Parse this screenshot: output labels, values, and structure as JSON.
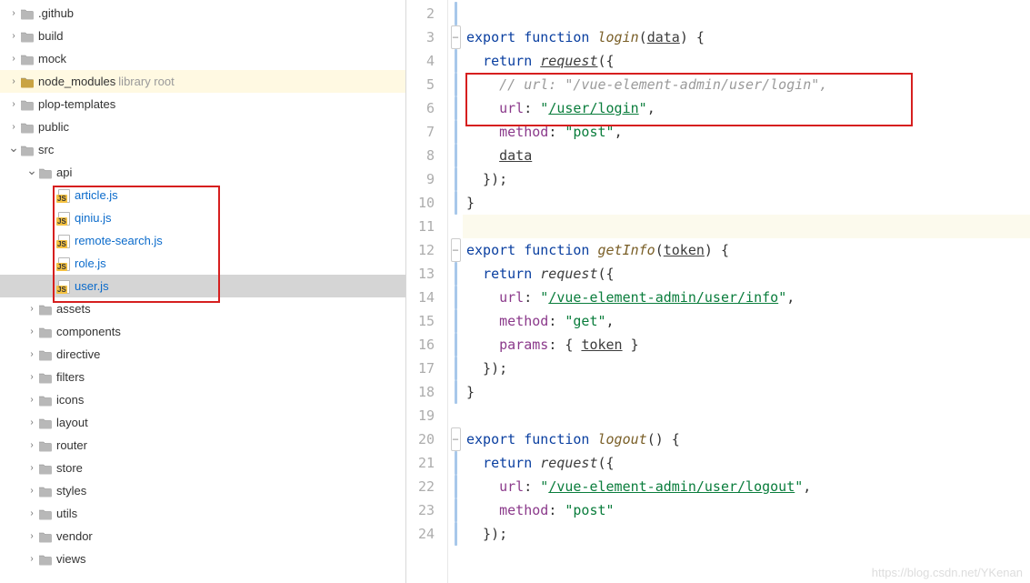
{
  "tree": [
    {
      "indent": 0,
      "chev": "right",
      "icon": "folder",
      "label": ".github"
    },
    {
      "indent": 0,
      "chev": "right",
      "icon": "folder",
      "label": "build"
    },
    {
      "indent": 0,
      "chev": "right",
      "icon": "folder",
      "label": "mock"
    },
    {
      "indent": 0,
      "chev": "right",
      "icon": "folder-lib",
      "label": "node_modules",
      "extra": "library root",
      "lib": true
    },
    {
      "indent": 0,
      "chev": "right",
      "icon": "folder",
      "label": "plop-templates"
    },
    {
      "indent": 0,
      "chev": "right",
      "icon": "folder",
      "label": "public"
    },
    {
      "indent": 0,
      "chev": "down",
      "icon": "folder",
      "label": "src"
    },
    {
      "indent": 1,
      "chev": "down",
      "icon": "folder",
      "label": "api"
    },
    {
      "indent": 2,
      "chev": "none",
      "icon": "js",
      "label": "article.js",
      "link": true
    },
    {
      "indent": 2,
      "chev": "none",
      "icon": "js",
      "label": "qiniu.js",
      "link": true
    },
    {
      "indent": 2,
      "chev": "none",
      "icon": "js",
      "label": "remote-search.js",
      "link": true
    },
    {
      "indent": 2,
      "chev": "none",
      "icon": "js",
      "label": "role.js",
      "link": true
    },
    {
      "indent": 2,
      "chev": "none",
      "icon": "js",
      "label": "user.js",
      "link": true,
      "selected": true
    },
    {
      "indent": 1,
      "chev": "right",
      "icon": "folder",
      "label": "assets"
    },
    {
      "indent": 1,
      "chev": "right",
      "icon": "folder",
      "label": "components"
    },
    {
      "indent": 1,
      "chev": "right",
      "icon": "folder",
      "label": "directive"
    },
    {
      "indent": 1,
      "chev": "right",
      "icon": "folder",
      "label": "filters"
    },
    {
      "indent": 1,
      "chev": "right",
      "icon": "folder",
      "label": "icons"
    },
    {
      "indent": 1,
      "chev": "right",
      "icon": "folder",
      "label": "layout"
    },
    {
      "indent": 1,
      "chev": "right",
      "icon": "folder",
      "label": "router"
    },
    {
      "indent": 1,
      "chev": "right",
      "icon": "folder",
      "label": "store"
    },
    {
      "indent": 1,
      "chev": "right",
      "icon": "folder",
      "label": "styles"
    },
    {
      "indent": 1,
      "chev": "right",
      "icon": "folder",
      "label": "utils"
    },
    {
      "indent": 1,
      "chev": "right",
      "icon": "folder",
      "label": "vendor"
    },
    {
      "indent": 1,
      "chev": "right",
      "icon": "folder",
      "label": "views"
    }
  ],
  "lines": [
    {
      "num": 2,
      "mark": "bar",
      "tokens": []
    },
    {
      "num": 3,
      "mark": "minus",
      "tokens": [
        {
          "t": "export ",
          "c": "kw"
        },
        {
          "t": "function ",
          "c": "kw"
        },
        {
          "t": "login",
          "c": "fn"
        },
        {
          "t": "(",
          "c": "plain"
        },
        {
          "t": "data",
          "c": "param"
        },
        {
          "t": ") {",
          "c": "plain"
        }
      ]
    },
    {
      "num": 4,
      "mark": "bar",
      "tokens": [
        {
          "t": "  ",
          "c": "plain"
        },
        {
          "t": "return ",
          "c": "kw"
        },
        {
          "t": "request",
          "c": "fncall underline"
        },
        {
          "t": "({",
          "c": "plain"
        }
      ]
    },
    {
      "num": 5,
      "mark": "bar",
      "tokens": [
        {
          "t": "    ",
          "c": "plain"
        },
        {
          "t": "// url: \"/vue-element-admin/user/login\",",
          "c": "comment"
        }
      ]
    },
    {
      "num": 6,
      "mark": "bar",
      "tokens": [
        {
          "t": "    ",
          "c": "plain"
        },
        {
          "t": "url",
          "c": "prop"
        },
        {
          "t": ": ",
          "c": "plain"
        },
        {
          "t": "\"",
          "c": "str"
        },
        {
          "t": "/user/login",
          "c": "str underline"
        },
        {
          "t": "\"",
          "c": "str"
        },
        {
          "t": ",",
          "c": "plain"
        }
      ]
    },
    {
      "num": 7,
      "mark": "bar",
      "tokens": [
        {
          "t": "    ",
          "c": "plain"
        },
        {
          "t": "method",
          "c": "prop"
        },
        {
          "t": ": ",
          "c": "plain"
        },
        {
          "t": "\"post\"",
          "c": "str"
        },
        {
          "t": ",",
          "c": "plain"
        }
      ]
    },
    {
      "num": 8,
      "mark": "bar",
      "tokens": [
        {
          "t": "    ",
          "c": "plain"
        },
        {
          "t": "data",
          "c": "param"
        }
      ]
    },
    {
      "num": 9,
      "mark": "bar",
      "tokens": [
        {
          "t": "  });",
          "c": "plain"
        }
      ]
    },
    {
      "num": 10,
      "mark": "bar",
      "tokens": [
        {
          "t": "}",
          "c": "plain"
        }
      ]
    },
    {
      "num": 11,
      "mark": "",
      "caret": true,
      "tokens": []
    },
    {
      "num": 12,
      "mark": "minus",
      "tokens": [
        {
          "t": "export ",
          "c": "kw"
        },
        {
          "t": "function ",
          "c": "kw"
        },
        {
          "t": "getInfo",
          "c": "fn"
        },
        {
          "t": "(",
          "c": "plain"
        },
        {
          "t": "token",
          "c": "param"
        },
        {
          "t": ") {",
          "c": "plain"
        }
      ]
    },
    {
      "num": 13,
      "mark": "bar",
      "tokens": [
        {
          "t": "  ",
          "c": "plain"
        },
        {
          "t": "return ",
          "c": "kw"
        },
        {
          "t": "request",
          "c": "fncall"
        },
        {
          "t": "({",
          "c": "plain"
        }
      ]
    },
    {
      "num": 14,
      "mark": "bar",
      "tokens": [
        {
          "t": "    ",
          "c": "plain"
        },
        {
          "t": "url",
          "c": "prop"
        },
        {
          "t": ": ",
          "c": "plain"
        },
        {
          "t": "\"",
          "c": "str"
        },
        {
          "t": "/vue-element-admin/user/info",
          "c": "str underline"
        },
        {
          "t": "\"",
          "c": "str"
        },
        {
          "t": ",",
          "c": "plain"
        }
      ]
    },
    {
      "num": 15,
      "mark": "bar",
      "tokens": [
        {
          "t": "    ",
          "c": "plain"
        },
        {
          "t": "method",
          "c": "prop"
        },
        {
          "t": ": ",
          "c": "plain"
        },
        {
          "t": "\"get\"",
          "c": "str"
        },
        {
          "t": ",",
          "c": "plain"
        }
      ]
    },
    {
      "num": 16,
      "mark": "bar",
      "tokens": [
        {
          "t": "    ",
          "c": "plain"
        },
        {
          "t": "params",
          "c": "prop"
        },
        {
          "t": ": { ",
          "c": "plain"
        },
        {
          "t": "token",
          "c": "param"
        },
        {
          "t": " }",
          "c": "plain"
        }
      ]
    },
    {
      "num": 17,
      "mark": "bar",
      "tokens": [
        {
          "t": "  });",
          "c": "plain"
        }
      ]
    },
    {
      "num": 18,
      "mark": "bar",
      "tokens": [
        {
          "t": "}",
          "c": "plain"
        }
      ]
    },
    {
      "num": 19,
      "mark": "",
      "tokens": []
    },
    {
      "num": 20,
      "mark": "minus",
      "tokens": [
        {
          "t": "export ",
          "c": "kw"
        },
        {
          "t": "function ",
          "c": "kw"
        },
        {
          "t": "logout",
          "c": "fn"
        },
        {
          "t": "() {",
          "c": "plain"
        }
      ]
    },
    {
      "num": 21,
      "mark": "bar",
      "tokens": [
        {
          "t": "  ",
          "c": "plain"
        },
        {
          "t": "return ",
          "c": "kw"
        },
        {
          "t": "request",
          "c": "fncall"
        },
        {
          "t": "({",
          "c": "plain"
        }
      ]
    },
    {
      "num": 22,
      "mark": "bar",
      "tokens": [
        {
          "t": "    ",
          "c": "plain"
        },
        {
          "t": "url",
          "c": "prop"
        },
        {
          "t": ": ",
          "c": "plain"
        },
        {
          "t": "\"",
          "c": "str"
        },
        {
          "t": "/vue-element-admin/user/logout",
          "c": "str underline"
        },
        {
          "t": "\"",
          "c": "str"
        },
        {
          "t": ",",
          "c": "plain"
        }
      ]
    },
    {
      "num": 23,
      "mark": "bar",
      "tokens": [
        {
          "t": "    ",
          "c": "plain"
        },
        {
          "t": "method",
          "c": "prop"
        },
        {
          "t": ": ",
          "c": "plain"
        },
        {
          "t": "\"post\"",
          "c": "str"
        }
      ]
    },
    {
      "num": 24,
      "mark": "bar",
      "tokens": [
        {
          "t": "  });",
          "c": "plain"
        }
      ]
    }
  ],
  "watermark": "https://blog.csdn.net/YKenan"
}
